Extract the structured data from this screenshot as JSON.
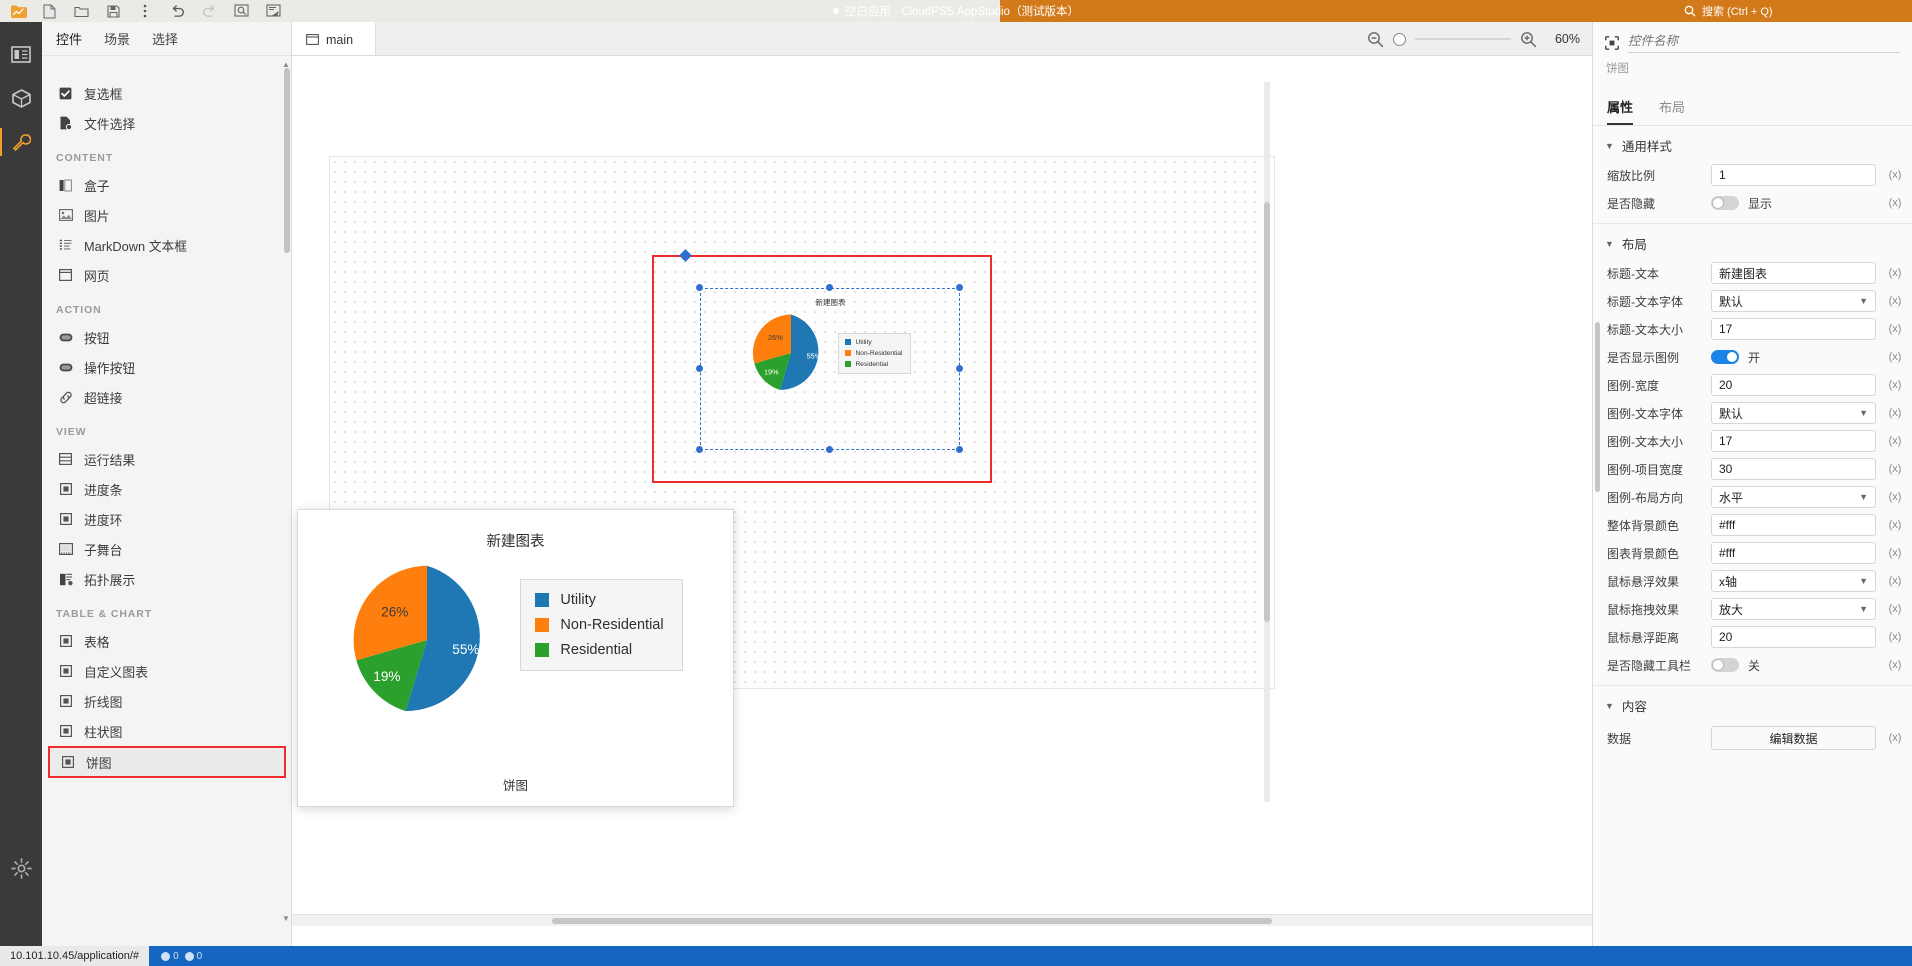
{
  "titlebar": {
    "app_title": "空白应用 - CloudPSS AppStudio（测试版本）",
    "search_placeholder": "搜索 (Ctrl + Q)",
    "accent_color": "#d2791a",
    "icons": [
      "logo-icon",
      "new-file-icon",
      "open-folder-icon",
      "save-icon",
      "more-vertical-icon",
      "undo-icon",
      "redo-icon",
      "inspect-icon",
      "annotate-icon"
    ]
  },
  "rail": {
    "items": [
      {
        "name": "layout-icon"
      },
      {
        "name": "package-icon"
      },
      {
        "name": "tools-icon"
      },
      {
        "name": "settings-icon"
      }
    ]
  },
  "widget_panel": {
    "tabs": [
      {
        "label": "控件",
        "active": true
      },
      {
        "label": "场景",
        "active": false
      },
      {
        "label": "选择",
        "active": false
      }
    ],
    "items": [
      {
        "label": "复选框",
        "icon": "checkbox-icon",
        "group": null
      },
      {
        "label": "文件选择",
        "icon": "file-picker-icon",
        "group": null
      },
      {
        "label": "CONTENT",
        "group": true
      },
      {
        "label": "盒子",
        "icon": "box-icon"
      },
      {
        "label": "图片",
        "icon": "image-icon"
      },
      {
        "label": "MarkDown 文本框",
        "icon": "markdown-icon"
      },
      {
        "label": "网页",
        "icon": "webpage-icon"
      },
      {
        "label": "ACTION",
        "group": true
      },
      {
        "label": "按钮",
        "icon": "button-icon"
      },
      {
        "label": "操作按钮",
        "icon": "action-button-icon"
      },
      {
        "label": "超链接",
        "icon": "link-icon"
      },
      {
        "label": "VIEW",
        "group": true
      },
      {
        "label": "运行结果",
        "icon": "result-icon"
      },
      {
        "label": "进度条",
        "icon": "progress-bar-icon"
      },
      {
        "label": "进度环",
        "icon": "progress-ring-icon"
      },
      {
        "label": "子舞台",
        "icon": "sub-stage-icon"
      },
      {
        "label": "拓扑展示",
        "icon": "topology-icon"
      },
      {
        "label": "TABLE & CHART",
        "group": true
      },
      {
        "label": "表格",
        "icon": "table-icon"
      },
      {
        "label": "自定义图表",
        "icon": "custom-chart-icon"
      },
      {
        "label": "折线图",
        "icon": "line-chart-icon"
      },
      {
        "label": "柱状图",
        "icon": "bar-chart-icon"
      },
      {
        "label": "饼图",
        "icon": "pie-chart-icon",
        "selected": true
      }
    ],
    "selected_highlight_color": "#ef2b2b"
  },
  "canvas": {
    "tab": {
      "label": "main",
      "icon": "stage-icon"
    },
    "zoom": {
      "label": "60%",
      "zoom_out_icon": "zoom-out-icon",
      "zoom_in_icon": "zoom-in-icon"
    }
  },
  "chart_data": {
    "type": "pie",
    "title": "新建图表",
    "labels": [
      "Utility",
      "Non-Residential",
      "Residential"
    ],
    "values": [
      55,
      26,
      19
    ],
    "value_labels": [
      "55%",
      "26%",
      "19%"
    ],
    "colors": [
      "#1f77b4",
      "#ff7f0e",
      "#2ca02c"
    ],
    "legend_position": "right",
    "legend_labels": [
      "Utility",
      "Non-Residential",
      "Residential"
    ]
  },
  "popup": {
    "title": "新建图表",
    "footer_label": "饼图"
  },
  "properties": {
    "name_placeholder": "控件名称",
    "name_value": "",
    "widget_type": "饼图",
    "tabs": [
      {
        "label": "属性",
        "active": true
      },
      {
        "label": "布局",
        "active": false
      }
    ],
    "sections": [
      {
        "title": "通用样式",
        "rows": [
          {
            "label": "缩放比例",
            "type": "input",
            "value": "1",
            "suffix": "(x)"
          },
          {
            "label": "是否隐藏",
            "type": "toggle",
            "on": false,
            "text": "显示",
            "suffix": "(x)"
          }
        ]
      },
      {
        "title": "布局",
        "rows": [
          {
            "label": "标题-文本",
            "type": "input",
            "value": "新建图表",
            "suffix": "(x)"
          },
          {
            "label": "标题-文本字体",
            "type": "select",
            "value": "默认",
            "suffix": "(x)"
          },
          {
            "label": "标题-文本大小",
            "type": "input",
            "value": "17",
            "suffix": "(x)"
          },
          {
            "label": "是否显示图例",
            "type": "toggle",
            "on": true,
            "text": "开",
            "suffix": "(x)"
          },
          {
            "label": "图例-宽度",
            "type": "input",
            "value": "20",
            "suffix": "(x)"
          },
          {
            "label": "图例-文本字体",
            "type": "select",
            "value": "默认",
            "suffix": "(x)"
          },
          {
            "label": "图例-文本大小",
            "type": "input",
            "value": "17",
            "suffix": "(x)"
          },
          {
            "label": "图例-项目宽度",
            "type": "input",
            "value": "30",
            "suffix": "(x)"
          },
          {
            "label": "图例-布局方向",
            "type": "select",
            "value": "水平",
            "suffix": "(x)"
          },
          {
            "label": "整体背景颜色",
            "type": "input",
            "value": "#fff",
            "suffix": "(x)"
          },
          {
            "label": "图表背景颜色",
            "type": "input",
            "value": "#fff",
            "suffix": "(x)"
          },
          {
            "label": "鼠标悬浮效果",
            "type": "select",
            "value": "x轴",
            "suffix": "(x)"
          },
          {
            "label": "鼠标拖拽效果",
            "type": "select",
            "value": "放大",
            "suffix": "(x)"
          },
          {
            "label": "鼠标悬浮距离",
            "type": "input",
            "value": "20",
            "suffix": "(x)"
          },
          {
            "label": "是否隐藏工具栏",
            "type": "toggle",
            "on": false,
            "text": "关",
            "suffix": "(x)"
          }
        ]
      },
      {
        "title": "内容",
        "rows": [
          {
            "label": "数据",
            "type": "button",
            "value": "编辑数据",
            "suffix": "(x)"
          }
        ]
      }
    ]
  },
  "statusbar": {
    "url": "10.101.10.45/application/#",
    "badge_count_a": "0",
    "badge_count_b": "0",
    "background": "#1566c0"
  }
}
